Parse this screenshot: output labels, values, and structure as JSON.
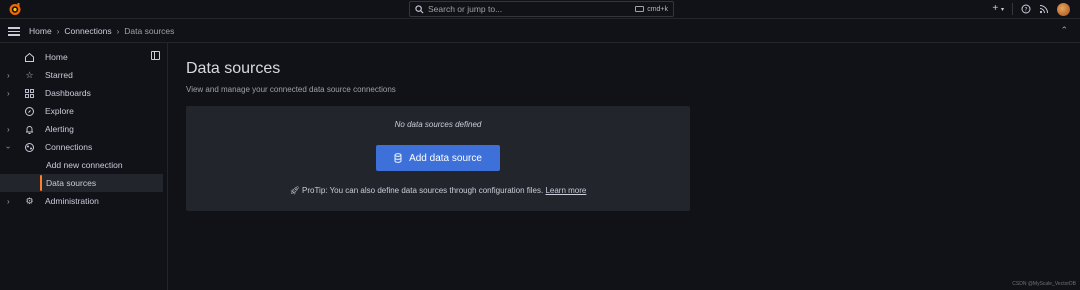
{
  "topbar": {
    "search_placeholder": "Search or jump to...",
    "shortcut": "cmd+k",
    "plus_label": "+",
    "icons": [
      "grafana-logo-icon",
      "search-icon",
      "plus-icon",
      "chevron-down-icon",
      "help-icon",
      "rss-icon",
      "avatar"
    ]
  },
  "breadcrumb": {
    "items": [
      "Home",
      "Connections",
      "Data sources"
    ]
  },
  "sidebar": {
    "items": [
      {
        "label": "Home",
        "icon": "home-icon",
        "expandable": false
      },
      {
        "label": "Starred",
        "icon": "star-icon",
        "expandable": true
      },
      {
        "label": "Dashboards",
        "icon": "grid-icon",
        "expandable": true
      },
      {
        "label": "Explore",
        "icon": "compass-icon",
        "expandable": false
      },
      {
        "label": "Alerting",
        "icon": "bell-icon",
        "expandable": true
      },
      {
        "label": "Connections",
        "icon": "connections-icon",
        "expandable": true,
        "expanded": true
      },
      {
        "label": "Add new connection",
        "sub": true
      },
      {
        "label": "Data sources",
        "sub": true,
        "active": true
      },
      {
        "label": "Administration",
        "icon": "gear-icon",
        "expandable": true
      }
    ]
  },
  "main": {
    "title": "Data sources",
    "description": "View and manage your connected data source connections",
    "empty_message": "No data sources defined",
    "add_button_label": "Add data source",
    "protip_text": "ProTip: You can also define data sources through configuration files.",
    "learn_more": "Learn more"
  },
  "watermark": "CSDN @MyScale_VectorDB",
  "colors": {
    "background": "#111217",
    "panel": "#22252b",
    "primary_button": "#3d71d9",
    "active_indicator": "#ff7f2a"
  }
}
